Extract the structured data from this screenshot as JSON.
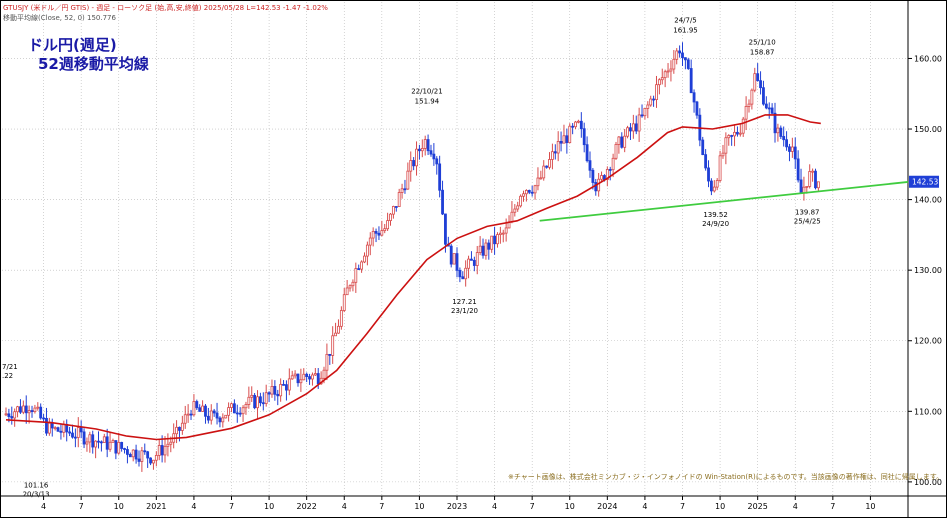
{
  "header": {
    "line1": "GTUSJY (米ドル／円 GTIS) - 週足 - ローソク足 (始,高,安,終値) 2025/05/28 L=142.53 -1.47 -1.02%",
    "line2": "移動平均線(Close, 52, 0) 150.776"
  },
  "title": {
    "line1": "ドル円(週足)",
    "line2": "52週移動平均線"
  },
  "footnote": "※チャート画像は、株式会社ミンカブ・ジ・インフォノイドの Win-Station(R)によるものです。当該画像の著作権は、同社に帰属します。",
  "colors": {
    "up": "#d84b4b",
    "down": "#1f3fd6",
    "ma": "#cc1111",
    "trend": "#3fcc3f",
    "price_tag": "#1f3fd6",
    "grid": "#b7b7b7"
  },
  "chart_data": {
    "type": "candlestick",
    "symbol": "GTUSJY",
    "timeframe": "weekly",
    "last_price": "142.53",
    "ylim": [
      98,
      168
    ],
    "yticks": [
      "100.00",
      "110.00",
      "120.00",
      "130.00",
      "140.00",
      "150.00",
      "160.00"
    ],
    "xticks": [
      {
        "label": "4",
        "t": 2020.25
      },
      {
        "label": "7",
        "t": 2020.5
      },
      {
        "label": "10",
        "t": 2020.75
      },
      {
        "label": "2021",
        "t": 2021.0
      },
      {
        "label": "4",
        "t": 2021.25
      },
      {
        "label": "7",
        "t": 2021.5
      },
      {
        "label": "10",
        "t": 2021.75
      },
      {
        "label": "2022",
        "t": 2022.0
      },
      {
        "label": "4",
        "t": 2022.25
      },
      {
        "label": "7",
        "t": 2022.5
      },
      {
        "label": "10",
        "t": 2022.75
      },
      {
        "label": "2023",
        "t": 2023.0
      },
      {
        "label": "4",
        "t": 2023.25
      },
      {
        "label": "7",
        "t": 2023.5
      },
      {
        "label": "10",
        "t": 2023.75
      },
      {
        "label": "2024",
        "t": 2024.0
      },
      {
        "label": "4",
        "t": 2024.25
      },
      {
        "label": "7",
        "t": 2024.5
      },
      {
        "label": "10",
        "t": 2024.75
      },
      {
        "label": "2025",
        "t": 2025.0
      },
      {
        "label": "4",
        "t": 2025.25
      },
      {
        "label": "7",
        "t": 2025.5
      },
      {
        "label": "10",
        "t": 2025.75
      }
    ],
    "price_path": [
      [
        2020.0,
        109.5
      ],
      [
        2020.18,
        111.0
      ],
      [
        2020.3,
        107.5
      ],
      [
        2020.45,
        107.0
      ],
      [
        2020.6,
        106.0
      ],
      [
        2020.75,
        105.0
      ],
      [
        2020.9,
        104.0
      ],
      [
        2021.0,
        103.5
      ],
      [
        2021.15,
        106.5
      ],
      [
        2021.25,
        110.5
      ],
      [
        2021.4,
        109.0
      ],
      [
        2021.55,
        110.5
      ],
      [
        2021.75,
        112.0
      ],
      [
        2021.9,
        114.0
      ],
      [
        2022.0,
        115.0
      ],
      [
        2022.1,
        115.0
      ],
      [
        2022.2,
        120.0
      ],
      [
        2022.3,
        128.0
      ],
      [
        2022.45,
        135.0
      ],
      [
        2022.55,
        136.0
      ],
      [
        2022.7,
        144.0
      ],
      [
        2022.8,
        148.5
      ],
      [
        2022.88,
        146.5
      ],
      [
        2022.95,
        133.0
      ],
      [
        2023.05,
        129.5
      ],
      [
        2023.2,
        133.0
      ],
      [
        2023.35,
        135.5
      ],
      [
        2023.45,
        141.5
      ],
      [
        2023.55,
        142.0
      ],
      [
        2023.7,
        148.0
      ],
      [
        2023.83,
        150.5
      ],
      [
        2023.95,
        141.5
      ],
      [
        2024.1,
        148.0
      ],
      [
        2024.25,
        151.5
      ],
      [
        2024.35,
        156.0
      ],
      [
        2024.5,
        161.5
      ],
      [
        2024.58,
        156.0
      ],
      [
        2024.68,
        143.0
      ],
      [
        2024.72,
        141.5
      ],
      [
        2024.8,
        147.5
      ],
      [
        2024.9,
        150.0
      ],
      [
        2025.0,
        157.5
      ],
      [
        2025.05,
        155.0
      ],
      [
        2025.15,
        149.5
      ],
      [
        2025.25,
        147.5
      ],
      [
        2025.3,
        140.5
      ],
      [
        2025.36,
        143.5
      ],
      [
        2025.41,
        142.5
      ]
    ],
    "ma_path": [
      [
        2020.0,
        108.8
      ],
      [
        2020.3,
        108.4
      ],
      [
        2020.6,
        107.5
      ],
      [
        2020.8,
        106.5
      ],
      [
        2021.0,
        106.0
      ],
      [
        2021.2,
        106.3
      ],
      [
        2021.5,
        107.6
      ],
      [
        2021.75,
        109.5
      ],
      [
        2022.0,
        112.5
      ],
      [
        2022.2,
        115.8
      ],
      [
        2022.4,
        121.0
      ],
      [
        2022.6,
        126.5
      ],
      [
        2022.8,
        131.5
      ],
      [
        2023.0,
        134.5
      ],
      [
        2023.2,
        136.2
      ],
      [
        2023.4,
        137.0
      ],
      [
        2023.6,
        138.8
      ],
      [
        2023.8,
        140.5
      ],
      [
        2024.0,
        143.0
      ],
      [
        2024.2,
        146.0
      ],
      [
        2024.4,
        149.5
      ],
      [
        2024.5,
        150.3
      ],
      [
        2024.7,
        150.0
      ],
      [
        2024.9,
        150.8
      ],
      [
        2025.05,
        152.0
      ],
      [
        2025.2,
        152.0
      ],
      [
        2025.35,
        151.0
      ],
      [
        2025.42,
        150.8
      ]
    ],
    "trendline": [
      [
        2023.55,
        137.0
      ],
      [
        2026.0,
        142.5
      ]
    ],
    "annotations": [
      {
        "date": "20/3/13",
        "value": "101.16",
        "t": 2020.2,
        "y": 101.16,
        "pos": "below"
      },
      {
        "date": "22/10/21",
        "value": "151.94",
        "t": 2022.8,
        "y": 151.94,
        "pos": "above"
      },
      {
        "date": "23/1/20",
        "value": "127.21",
        "t": 2023.05,
        "y": 127.21,
        "pos": "below"
      },
      {
        "date": "24/7/5",
        "value": "161.95",
        "t": 2024.52,
        "y": 161.95,
        "pos": "above"
      },
      {
        "date": "24/9/20",
        "value": "139.52",
        "t": 2024.72,
        "y": 139.52,
        "pos": "below"
      },
      {
        "date": "25/1/10",
        "value": "158.87",
        "t": 2025.03,
        "y": 158.87,
        "pos": "above"
      },
      {
        "date": "25/4/25",
        "value": "139.87",
        "t": 2025.33,
        "y": 139.87,
        "pos": "below"
      }
    ],
    "edge_labels": [
      "7/21",
      ".22"
    ]
  }
}
